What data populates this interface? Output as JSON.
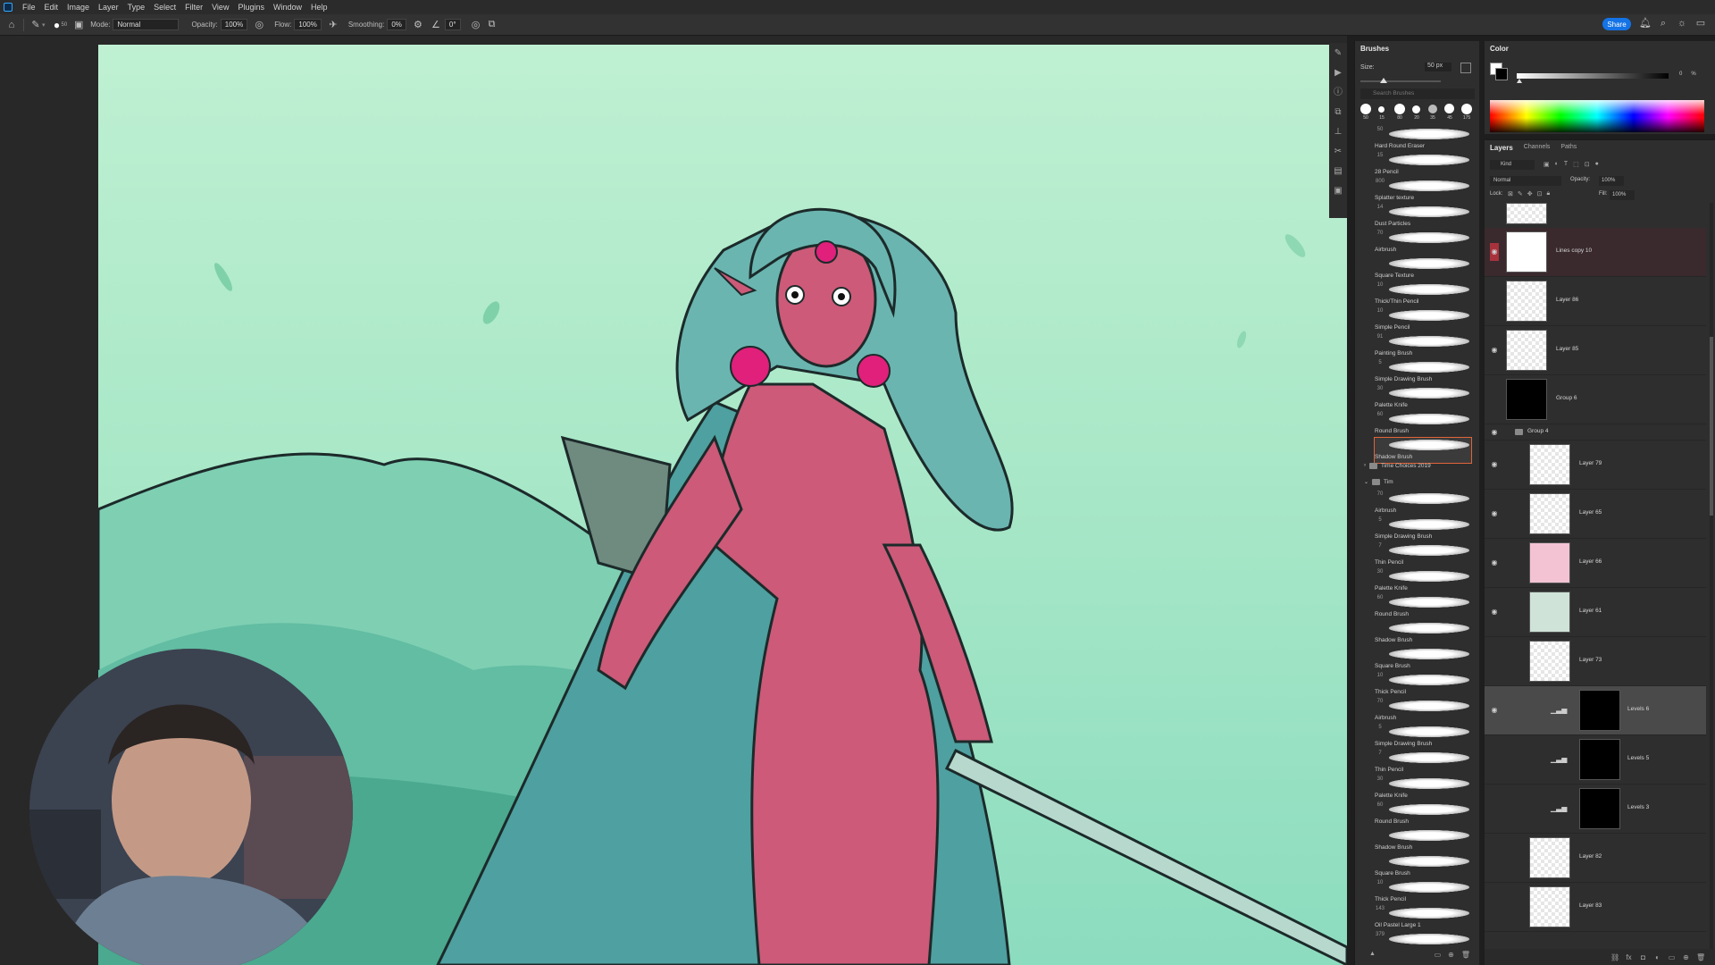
{
  "menubar": {
    "items": [
      "File",
      "Edit",
      "Image",
      "Layer",
      "Type",
      "Select",
      "Filter",
      "View",
      "Plugins",
      "Window",
      "Help"
    ]
  },
  "options_bar": {
    "mode_label": "Mode:",
    "mode_value": "Normal",
    "opacity_label": "Opacity:",
    "opacity_value": "100%",
    "flow_label": "Flow:",
    "flow_value": "100%",
    "smoothing_label": "Smoothing:",
    "smoothing_value": "0%",
    "angle_value": "0°",
    "brush_size": "50",
    "share_label": "Share"
  },
  "brushes_panel": {
    "title": "Brushes",
    "size_label": "Size:",
    "size_value": "50 px",
    "search_placeholder": "Search Brushes",
    "preset_sizes": [
      "50",
      "15",
      "80",
      "20",
      "35",
      "45",
      "175"
    ],
    "brushes_top": [
      {
        "size": "50",
        "label": "Hard Round Eraser"
      },
      {
        "size": "15",
        "label": "28 Pencil"
      },
      {
        "size": "800",
        "label": "Splatter texture"
      },
      {
        "size": "14",
        "label": "Dust Particles"
      },
      {
        "size": "70",
        "label": "Airbrush"
      },
      {
        "size": "",
        "label": "Square Texture"
      },
      {
        "size": "10",
        "label": "Thick/Thin Pencil"
      },
      {
        "size": "10",
        "label": "Simple Pencil"
      },
      {
        "size": "91",
        "label": "Painting Brush"
      },
      {
        "size": "5",
        "label": "Simple Drawing Brush"
      },
      {
        "size": "30",
        "label": "Palette Knife"
      },
      {
        "size": "60",
        "label": "Round Brush"
      },
      {
        "size": "",
        "label": "Shadow Brush"
      }
    ],
    "folders": [
      {
        "label": "Time Choices 2019"
      },
      {
        "label": "Tim"
      }
    ],
    "brushes_bottom": [
      {
        "size": "70",
        "label": "Airbrush"
      },
      {
        "size": "5",
        "label": "Simple Drawing Brush"
      },
      {
        "size": "7",
        "label": "Thin Pencil"
      },
      {
        "size": "30",
        "label": "Palette Knife"
      },
      {
        "size": "60",
        "label": "Round Brush"
      },
      {
        "size": "",
        "label": "Shadow Brush"
      },
      {
        "size": "",
        "label": "Square Brush"
      },
      {
        "size": "10",
        "label": "Thick Pencil"
      },
      {
        "size": "70",
        "label": "Airbrush"
      },
      {
        "size": "5",
        "label": "Simple Drawing Brush"
      },
      {
        "size": "7",
        "label": "Thin Pencil"
      },
      {
        "size": "30",
        "label": "Palette Knife"
      },
      {
        "size": "60",
        "label": "Round Brush"
      },
      {
        "size": "",
        "label": "Shadow Brush"
      },
      {
        "size": "",
        "label": "Square Brush"
      },
      {
        "size": "10",
        "label": "Thick Pencil"
      },
      {
        "size": "143",
        "label": "Oil Pastel Large 1"
      },
      {
        "size": "379",
        "label": ""
      }
    ]
  },
  "color_panel": {
    "title": "Color",
    "k_value": "0",
    "k_suffix": "%"
  },
  "layers_panel": {
    "tabs": [
      "Layers",
      "Channels",
      "Paths"
    ],
    "kind_label": "Kind",
    "blend_mode": "Normal",
    "opacity_label": "Opacity:",
    "opacity_value": "100%",
    "lock_label": "Lock:",
    "fill_label": "Fill:",
    "fill_value": "100%",
    "layers": [
      {
        "name": "Lines copy 10",
        "visible": true,
        "indent": 0,
        "active": false
      },
      {
        "name": "Layer 86",
        "visible": false,
        "indent": 0,
        "active": false
      },
      {
        "name": "Layer 85",
        "visible": true,
        "indent": 0,
        "active": false
      },
      {
        "name": "Group 6",
        "visible": false,
        "indent": 0,
        "active": false
      },
      {
        "name": "Group 4",
        "visible": true,
        "indent": 0,
        "active": false
      },
      {
        "name": "Layer 79",
        "visible": true,
        "indent": 1,
        "active": false
      },
      {
        "name": "Layer 65",
        "visible": true,
        "indent": 1,
        "active": false
      },
      {
        "name": "Layer 66",
        "visible": true,
        "indent": 1,
        "active": false
      },
      {
        "name": "Layer 61",
        "visible": true,
        "indent": 1,
        "active": false
      },
      {
        "name": "Layer 73",
        "visible": false,
        "indent": 1,
        "active": false
      },
      {
        "name": "Levels 6",
        "visible": true,
        "indent": 1,
        "active": true
      },
      {
        "name": "Levels 5",
        "visible": false,
        "indent": 1,
        "active": false
      },
      {
        "name": "Levels 3",
        "visible": false,
        "indent": 1,
        "active": false
      },
      {
        "name": "Layer 82",
        "visible": false,
        "indent": 1,
        "active": false
      },
      {
        "name": "Layer 83",
        "visible": false,
        "indent": 1,
        "active": false
      }
    ]
  },
  "icons": {
    "menubar_logo": "photoshop-logo-icon",
    "home": "home-icon",
    "brush": "brush-tool-icon",
    "bell": "bell-icon",
    "search": "search-icon",
    "eye": "eye-icon"
  },
  "colors": {
    "accent": "#1473e6",
    "selection": "#e0643a",
    "canvas_bg": "#bff0d2",
    "skin": "#cc5a78",
    "hair": "#6ab5b0",
    "earring": "#e0207a"
  }
}
